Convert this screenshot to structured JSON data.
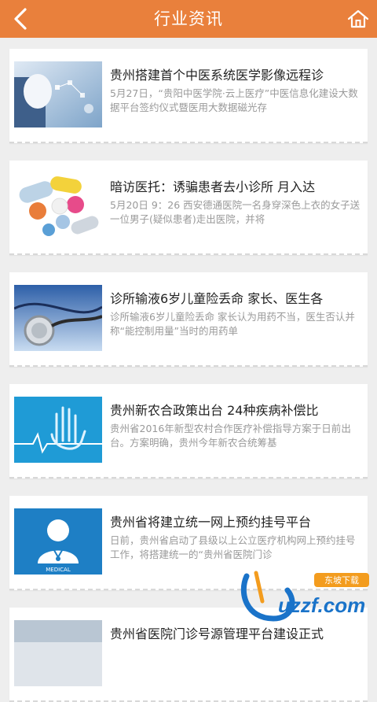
{
  "header": {
    "back_icon": "chevron-left-icon",
    "title": "行业资讯",
    "home_icon": "home-icon"
  },
  "articles": [
    {
      "title": "贵州搭建首个中医系统医学影像远程诊",
      "summary": "5月27日，“贵阳中医学院·云上医疗”中医信息化建设大数据平台签约仪式暨医用大数据磁光存",
      "thumb_icon": "medical-tech-image"
    },
    {
      "title": "暗访医托：诱骗患者去小诊所 月入达",
      "summary": "5月20日 9：26 西安德通医院一名身穿深色上衣的女子送一位男子(疑似患者)走出医院，并将",
      "thumb_icon": "pills-image"
    },
    {
      "title": "诊所输液6岁儿童险丢命 家长、医生各",
      "summary": "诊所输液6岁儿童险丢命 家长认为用药不当，医生否认并称“能控制用量”当时的用药单",
      "thumb_icon": "stethoscope-image"
    },
    {
      "title": "贵州新农合政策出台 24种疾病补偿比",
      "summary": "贵州省2016年新型农村合作医疗补偿指导方案于日前出台。方案明确，贵州今年新农合统筹基",
      "thumb_icon": "heartbeat-hand-image"
    },
    {
      "title": "贵州省将建立统一网上预约挂号平台",
      "summary": "日前，贵州省启动了县级以上公立医疗机构网上预约挂号工作，将搭建统一的“贵州省医院门诊",
      "thumb_icon": "doctor-medical-image",
      "thumb_caption": "MEDICAL"
    },
    {
      "title": "贵州省医院门诊号源管理平台建设正式",
      "summary": "",
      "thumb_icon": "medical-image"
    }
  ],
  "watermark": {
    "brand": "uzzf.com",
    "subtitle": "东坡下载"
  }
}
